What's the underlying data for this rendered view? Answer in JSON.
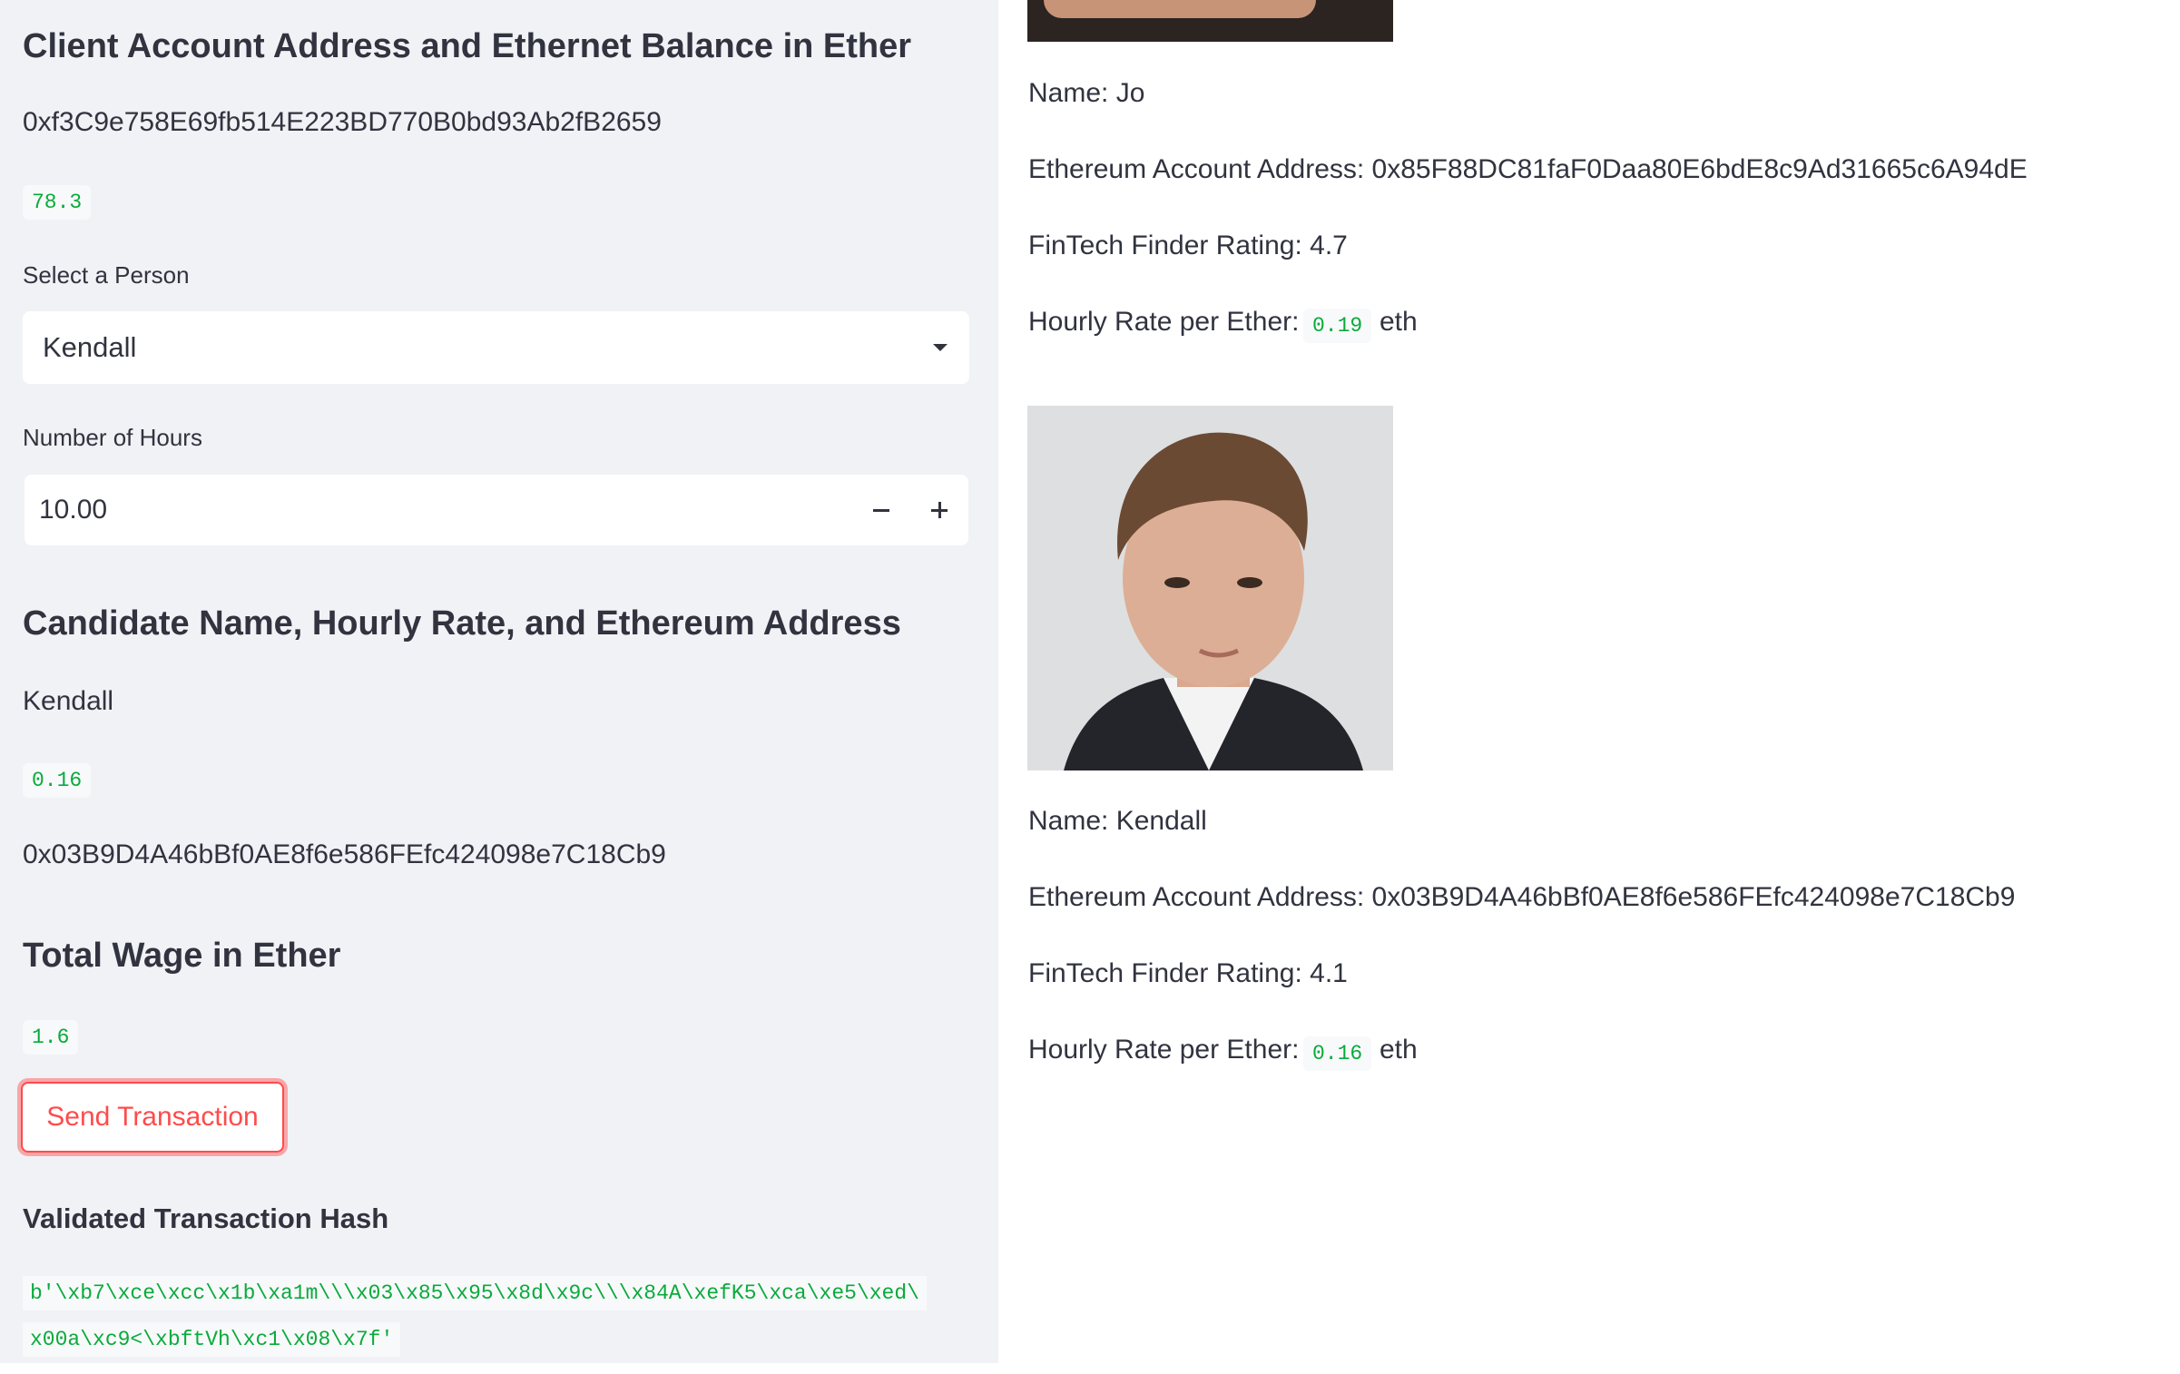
{
  "client": {
    "heading": "Client Account Address and Ethernet Balance in Ether",
    "address": "0xf3C9e758E69fb514E223BD770B0bd93Ab2fB2659",
    "balance": "78.3"
  },
  "select_person": {
    "label": "Select a Person",
    "selected": "Kendall"
  },
  "hours": {
    "label": "Number of Hours",
    "value": "10.00"
  },
  "candidate": {
    "heading": "Candidate Name, Hourly Rate, and Ethereum Address",
    "name": "Kendall",
    "rate": "0.16",
    "address": "0x03B9D4A46bBf0AE8f6e586FEfc424098e7C18Cb9"
  },
  "wage": {
    "heading": "Total Wage in Ether",
    "value": "1.6"
  },
  "send_button": "Send Transaction",
  "tx": {
    "heading": "Validated Transaction Hash",
    "line1": "b'\\xb7\\xce\\xcc\\x1b\\xa1m\\\\\\x03\\x85\\x95\\x8d\\x9c\\\\\\x84A\\xefK5\\xca\\xe5\\xed\\",
    "line2": "x00a\\xc9<\\xbftVh\\xc1\\x08\\x7f'"
  },
  "profiles": [
    {
      "name": "Name: Jo",
      "address": "Ethereum Account Address: 0x85F88DC81faF0Daa80E6bdE8c9Ad31665c6A94dE",
      "rating": "FinTech Finder Rating: 4.7",
      "rate_label": "Hourly Rate per Ether:",
      "rate": "0.19",
      "unit": "eth"
    },
    {
      "name": "Name: Kendall",
      "address": "Ethereum Account Address: 0x03B9D4A46bBf0AE8f6e586FEfc424098e7C18Cb9",
      "rating": "FinTech Finder Rating: 4.1",
      "rate_label": "Hourly Rate per Ether:",
      "rate": "0.16",
      "unit": "eth"
    }
  ],
  "colors": {
    "sidebar_bg": "#f0f2f6",
    "accent": "#ff4b4b",
    "code_green": "#09ab3b",
    "text": "#31333f"
  }
}
